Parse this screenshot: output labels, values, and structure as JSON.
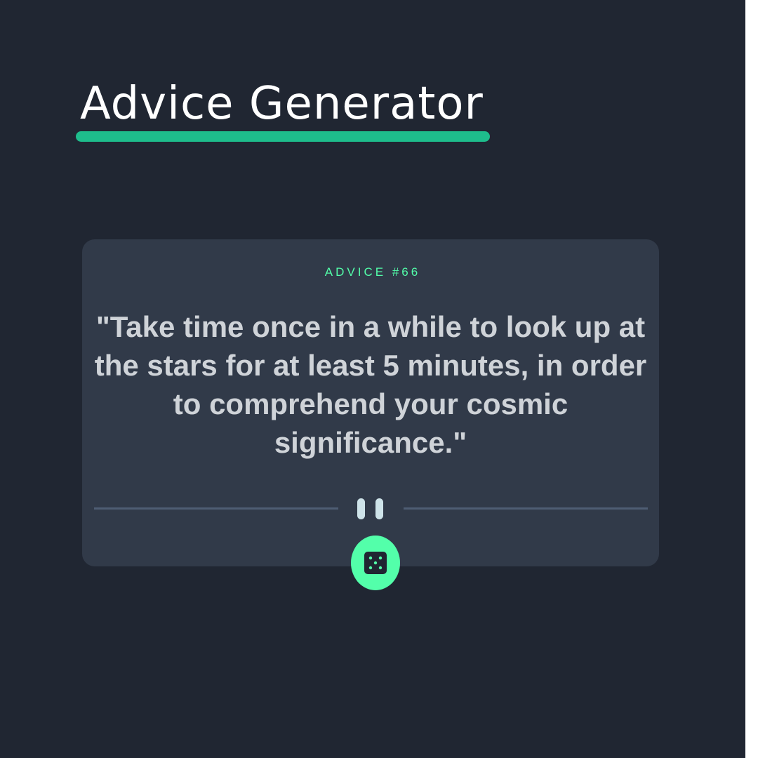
{
  "page": {
    "title": "Advice Generator"
  },
  "card": {
    "advice_label": "ADVICE #66",
    "quote": "\"Take time once in a while to look up at the stars for at least 5 minutes, in order to comprehend your cosmic significance.\""
  },
  "icons": {
    "divider_icon": "pause-icon",
    "button_icon": "dice-icon"
  },
  "colors": {
    "background": "#202632",
    "card": "#313a49",
    "accent": "#53ffaa",
    "underline": "#1ebd8c",
    "quote_text": "#cfd3d8"
  }
}
